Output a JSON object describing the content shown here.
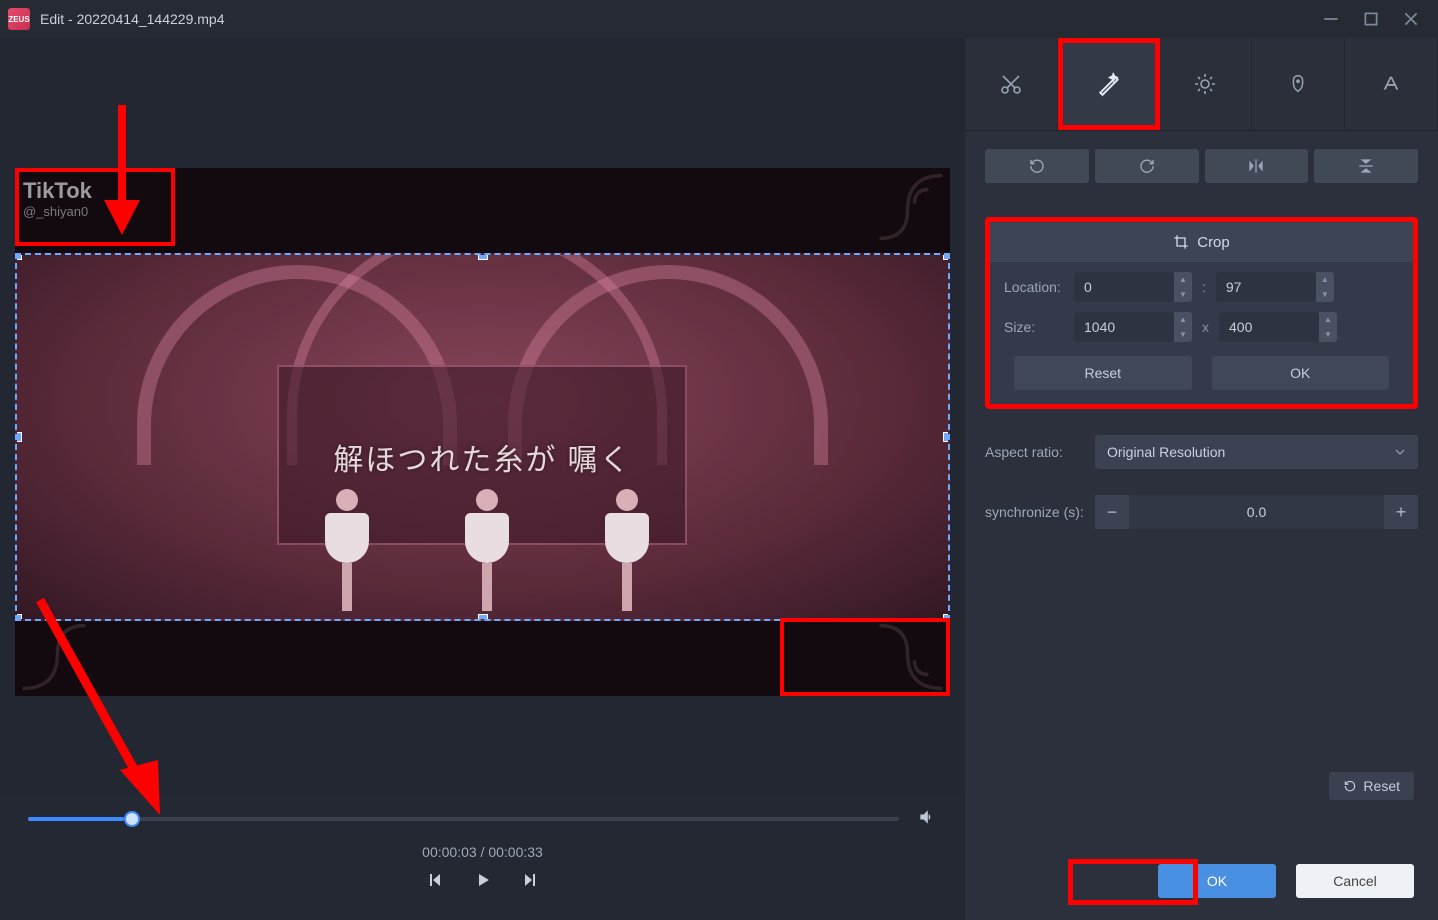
{
  "title": "Edit - 20220414_144229.mp4",
  "watermark": {
    "brand": "TikTok",
    "handle": "@_shiyan0"
  },
  "subtitle": "解ほつれた糸が 嘱く",
  "timeline": {
    "progress_pct": 11,
    "time_display": "00:00:03 / 00:00:33"
  },
  "tabs": {
    "cut": "cut",
    "effects": "effects",
    "adjust": "adjust",
    "watermark": "watermark",
    "text": "text"
  },
  "crop": {
    "header": "Crop",
    "location_label": "Location:",
    "size_label": "Size:",
    "x": "0",
    "y": "97",
    "w": "1040",
    "h": "400",
    "reset": "Reset",
    "ok": "OK"
  },
  "aspect": {
    "label": "Aspect ratio:",
    "value": "Original Resolution"
  },
  "sync": {
    "label": "synchronize (s):",
    "value": "0.0"
  },
  "footer": {
    "reset": "Reset",
    "ok": "OK",
    "cancel": "Cancel"
  }
}
